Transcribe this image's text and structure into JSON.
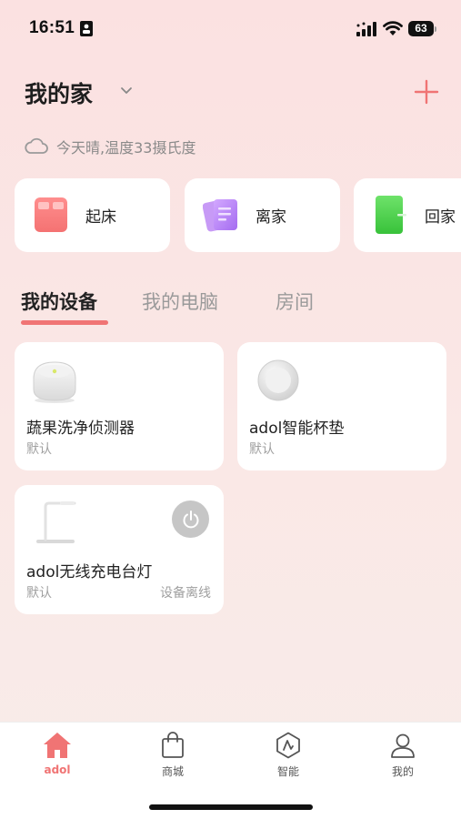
{
  "status_bar": {
    "time": "16:51",
    "battery": "63"
  },
  "header": {
    "home_name": "我的家"
  },
  "weather": {
    "text": "今天晴,温度33摄氏度"
  },
  "scenes": [
    {
      "label": "起床",
      "icon": "bed-icon"
    },
    {
      "label": "离家",
      "icon": "documents-icon"
    },
    {
      "label": "回家",
      "icon": "door-icon"
    }
  ],
  "tabs": [
    {
      "label": "我的设备",
      "active": true
    },
    {
      "label": "我的电脑",
      "active": false
    },
    {
      "label": "房间",
      "active": false
    }
  ],
  "devices": [
    {
      "name": "蔬果洗净侦测器",
      "room": "默认",
      "status": "",
      "icon": "detector-icon"
    },
    {
      "name": "adol智能杯垫",
      "room": "默认",
      "status": "",
      "icon": "coaster-icon"
    },
    {
      "name": "adol无线充电台灯",
      "room": "默认",
      "status": "设备离线",
      "icon": "desk-lamp-icon"
    }
  ],
  "bottom_nav": [
    {
      "label": "adol",
      "icon": "home-icon",
      "active": true
    },
    {
      "label": "商城",
      "icon": "shopping-bag-icon",
      "active": false
    },
    {
      "label": "智能",
      "icon": "smart-hexagon-icon",
      "active": false
    },
    {
      "label": "我的",
      "icon": "profile-icon",
      "active": false
    }
  ],
  "colors": {
    "accent": "#f07474",
    "background": "#fbe1e1",
    "card": "#ffffff"
  }
}
